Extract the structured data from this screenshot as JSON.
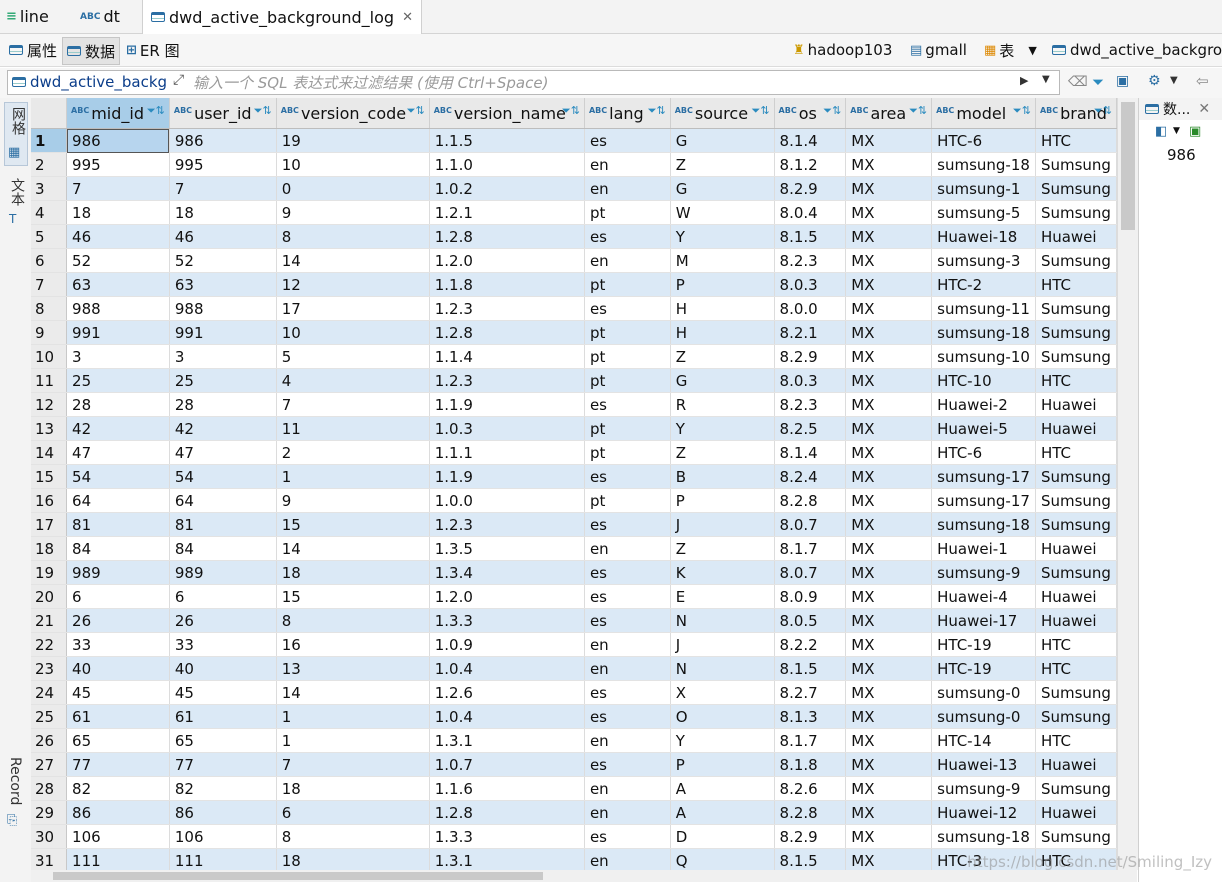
{
  "editor_tabs": [
    {
      "label": "line",
      "icon": "sql-script-icon"
    },
    {
      "label": "dt",
      "icon": "abc-column-icon"
    },
    {
      "label": "dwd_active_background_log",
      "icon": "table-icon",
      "active": true
    }
  ],
  "view_tabs": [
    {
      "label": "属性",
      "icon": "properties-icon"
    },
    {
      "label": "数据",
      "icon": "data-table-icon",
      "selected": true
    },
    {
      "label": "ER 图",
      "icon": "er-diagram-icon"
    }
  ],
  "breadcrumb": {
    "server": "hadoop103",
    "database": "gmall",
    "type": "表",
    "table": "dwd_active_backgrou"
  },
  "filter": {
    "table_name": "dwd_active_backg",
    "placeholder": "输入一个 SQL 表达式来过滤结果 (使用 Ctrl+Space)"
  },
  "side_labels": {
    "grid": "网格",
    "text": "文本",
    "record": "Record"
  },
  "columns": [
    "mid_id",
    "user_id",
    "version_code",
    "version_name",
    "lang",
    "source",
    "os",
    "area",
    "model",
    "brand"
  ],
  "rows": [
    [
      "986",
      "986",
      "19",
      "1.1.5",
      "es",
      "G",
      "8.1.4",
      "MX",
      "HTC-6",
      "HTC"
    ],
    [
      "995",
      "995",
      "10",
      "1.1.0",
      "en",
      "Z",
      "8.1.2",
      "MX",
      "sumsung-18",
      "Sumsung"
    ],
    [
      "7",
      "7",
      "0",
      "1.0.2",
      "en",
      "G",
      "8.2.9",
      "MX",
      "sumsung-1",
      "Sumsung"
    ],
    [
      "18",
      "18",
      "9",
      "1.2.1",
      "pt",
      "W",
      "8.0.4",
      "MX",
      "sumsung-5",
      "Sumsung"
    ],
    [
      "46",
      "46",
      "8",
      "1.2.8",
      "es",
      "Y",
      "8.1.5",
      "MX",
      "Huawei-18",
      "Huawei"
    ],
    [
      "52",
      "52",
      "14",
      "1.2.0",
      "en",
      "M",
      "8.2.3",
      "MX",
      "sumsung-3",
      "Sumsung"
    ],
    [
      "63",
      "63",
      "12",
      "1.1.8",
      "pt",
      "P",
      "8.0.3",
      "MX",
      "HTC-2",
      "HTC"
    ],
    [
      "988",
      "988",
      "17",
      "1.2.3",
      "es",
      "H",
      "8.0.0",
      "MX",
      "sumsung-11",
      "Sumsung"
    ],
    [
      "991",
      "991",
      "10",
      "1.2.8",
      "pt",
      "H",
      "8.2.1",
      "MX",
      "sumsung-18",
      "Sumsung"
    ],
    [
      "3",
      "3",
      "5",
      "1.1.4",
      "pt",
      "Z",
      "8.2.9",
      "MX",
      "sumsung-10",
      "Sumsung"
    ],
    [
      "25",
      "25",
      "4",
      "1.2.3",
      "pt",
      "G",
      "8.0.3",
      "MX",
      "HTC-10",
      "HTC"
    ],
    [
      "28",
      "28",
      "7",
      "1.1.9",
      "es",
      "R",
      "8.2.3",
      "MX",
      "Huawei-2",
      "Huawei"
    ],
    [
      "42",
      "42",
      "11",
      "1.0.3",
      "pt",
      "Y",
      "8.2.5",
      "MX",
      "Huawei-5",
      "Huawei"
    ],
    [
      "47",
      "47",
      "2",
      "1.1.1",
      "pt",
      "Z",
      "8.1.4",
      "MX",
      "HTC-6",
      "HTC"
    ],
    [
      "54",
      "54",
      "1",
      "1.1.9",
      "es",
      "B",
      "8.2.4",
      "MX",
      "sumsung-17",
      "Sumsung"
    ],
    [
      "64",
      "64",
      "9",
      "1.0.0",
      "pt",
      "P",
      "8.2.8",
      "MX",
      "sumsung-17",
      "Sumsung"
    ],
    [
      "81",
      "81",
      "15",
      "1.2.3",
      "es",
      "J",
      "8.0.7",
      "MX",
      "sumsung-18",
      "Sumsung"
    ],
    [
      "84",
      "84",
      "14",
      "1.3.5",
      "en",
      "Z",
      "8.1.7",
      "MX",
      "Huawei-1",
      "Huawei"
    ],
    [
      "989",
      "989",
      "18",
      "1.3.4",
      "es",
      "K",
      "8.0.7",
      "MX",
      "sumsung-9",
      "Sumsung"
    ],
    [
      "6",
      "6",
      "15",
      "1.2.0",
      "es",
      "E",
      "8.0.9",
      "MX",
      "Huawei-4",
      "Huawei"
    ],
    [
      "26",
      "26",
      "8",
      "1.3.3",
      "es",
      "N",
      "8.0.5",
      "MX",
      "Huawei-17",
      "Huawei"
    ],
    [
      "33",
      "33",
      "16",
      "1.0.9",
      "en",
      "J",
      "8.2.2",
      "MX",
      "HTC-19",
      "HTC"
    ],
    [
      "40",
      "40",
      "13",
      "1.0.4",
      "en",
      "N",
      "8.1.5",
      "MX",
      "HTC-19",
      "HTC"
    ],
    [
      "45",
      "45",
      "14",
      "1.2.6",
      "es",
      "X",
      "8.2.7",
      "MX",
      "sumsung-0",
      "Sumsung"
    ],
    [
      "61",
      "61",
      "1",
      "1.0.4",
      "es",
      "O",
      "8.1.3",
      "MX",
      "sumsung-0",
      "Sumsung"
    ],
    [
      "65",
      "65",
      "1",
      "1.3.1",
      "en",
      "Y",
      "8.1.7",
      "MX",
      "HTC-14",
      "HTC"
    ],
    [
      "77",
      "77",
      "7",
      "1.0.7",
      "es",
      "P",
      "8.1.8",
      "MX",
      "Huawei-13",
      "Huawei"
    ],
    [
      "82",
      "82",
      "18",
      "1.1.6",
      "en",
      "A",
      "8.2.6",
      "MX",
      "sumsung-9",
      "Sumsung"
    ],
    [
      "86",
      "86",
      "6",
      "1.2.8",
      "en",
      "A",
      "8.2.8",
      "MX",
      "Huawei-12",
      "Huawei"
    ],
    [
      "106",
      "106",
      "8",
      "1.3.3",
      "es",
      "D",
      "8.2.9",
      "MX",
      "sumsung-18",
      "Sumsung"
    ],
    [
      "111",
      "111",
      "18",
      "1.3.1",
      "en",
      "Q",
      "8.1.5",
      "MX",
      "HTC-3",
      "HTC"
    ]
  ],
  "value_panel": {
    "title": "数...",
    "value": "986"
  },
  "watermark": "https://blog.csdn.net/Smiling_Izy",
  "colors": {
    "selection": "#a8cde8",
    "odd_row": "#dbe9f6",
    "accent": "#2b6ea3"
  }
}
